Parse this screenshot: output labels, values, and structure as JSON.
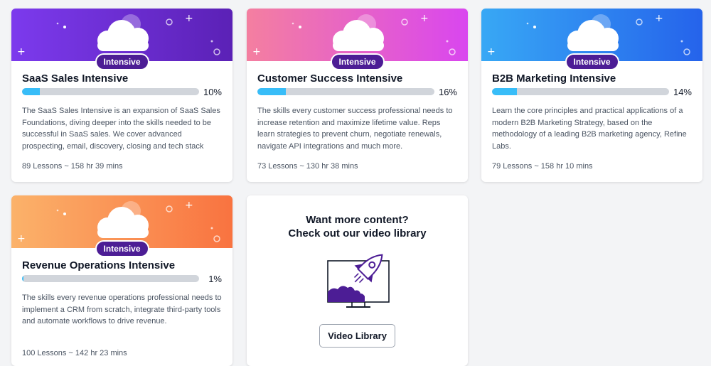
{
  "courses": [
    {
      "title": "SaaS Sales Intensive",
      "badge": "Intensive",
      "progress_pct": 10,
      "progress_label": "10%",
      "description": "The SaaS Sales Intensive is an expansion of SaaS Sales Foundations, diving deeper into the skills needed to be successful in SaaS sales. We cover advanced prospecting, email, discovery, closing and tech stack skills to help bot...",
      "meta": "89 Lessons ~ 158 hr 39 mins",
      "banner_colors": [
        "#7c3aed",
        "#5b21b6"
      ]
    },
    {
      "title": "Customer Success Intensive",
      "badge": "Intensive",
      "progress_pct": 16,
      "progress_label": "16%",
      "description": "The skills every customer success professional needs to increase retention and maximize lifetime value. Reps learn strategies to prevent churn, negotiate renewals, navigate API integrations and much more.",
      "meta": "73 Lessons ~ 130 hr 38 mins",
      "banner_colors": [
        "#f47fa0",
        "#d946ef"
      ]
    },
    {
      "title": "B2B Marketing Intensive",
      "badge": "Intensive",
      "progress_pct": 14,
      "progress_label": "14%",
      "description": "Learn the core principles and practical applications of a modern B2B Marketing Strategy, based on the methodology of a leading B2B marketing agency, Refine Labs.",
      "meta": "79 Lessons ~ 158 hr 10 mins",
      "banner_colors": [
        "#38a8f5",
        "#2563eb"
      ]
    },
    {
      "title": "Revenue Operations Intensive",
      "badge": "Intensive",
      "progress_pct": 1,
      "progress_label": "1%",
      "description": "The skills every revenue operations professional needs to implement a CRM from scratch, integrate third-party tools and automate workflows to drive revenue.",
      "meta": "100 Lessons ~ 142 hr 23 mins",
      "banner_colors": [
        "#fbb26a",
        "#f97340"
      ]
    }
  ],
  "promo": {
    "heading_line1": "Want more content?",
    "heading_line2": "Check out our video library",
    "button_label": "Video Library",
    "icon": "rocket-monitor-illustration",
    "accent": "#4c1d95"
  },
  "colors": {
    "badge": "#4c1d95",
    "progress_fill": "#38bdf8",
    "progress_track": "#d1d5db"
  }
}
